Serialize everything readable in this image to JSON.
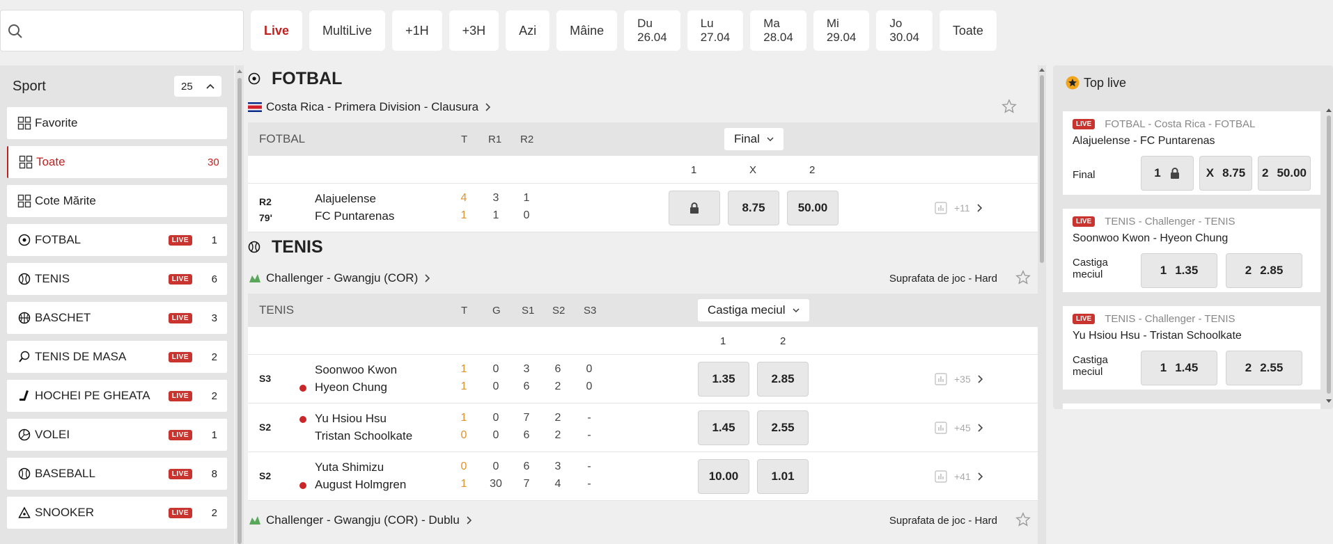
{
  "search": {
    "placeholder": "",
    "value": ""
  },
  "filters": {
    "live": "Live",
    "multilive": "MultiLive",
    "h1": "+1H",
    "h3": "+3H",
    "today": "Azi",
    "tomorrow": "Mâine",
    "dates": [
      {
        "day": "Du",
        "date": "26.04"
      },
      {
        "day": "Lu",
        "date": "27.04"
      },
      {
        "day": "Ma",
        "date": "28.04"
      },
      {
        "day": "Mi",
        "date": "29.04"
      },
      {
        "day": "Jo",
        "date": "30.04"
      }
    ],
    "all": "Toate"
  },
  "sidebar": {
    "title": "Sport",
    "count": "25",
    "items": [
      {
        "label": "Favorite",
        "icon": "grid-icon",
        "live": "",
        "count": ""
      },
      {
        "label": "Toate",
        "icon": "grid-icon",
        "live": "",
        "count": "30"
      },
      {
        "label": "Cote Mărite",
        "icon": "grid-icon",
        "live": "",
        "count": ""
      },
      {
        "label": "FOTBAL",
        "icon": "football-icon",
        "live": "LIVE",
        "count": "1"
      },
      {
        "label": "TENIS",
        "icon": "tennis-icon",
        "live": "LIVE",
        "count": "6"
      },
      {
        "label": "BASCHET",
        "icon": "basketball-icon",
        "live": "LIVE",
        "count": "3"
      },
      {
        "label": "TENIS DE MASA",
        "icon": "table-tennis-icon",
        "live": "LIVE",
        "count": "2"
      },
      {
        "label": "HOCHEI PE GHEATA",
        "icon": "hockey-icon",
        "live": "LIVE",
        "count": "2"
      },
      {
        "label": "VOLEI",
        "icon": "volleyball-icon",
        "live": "LIVE",
        "count": "1"
      },
      {
        "label": "BASEBALL",
        "icon": "baseball-icon",
        "live": "LIVE",
        "count": "8"
      },
      {
        "label": "SNOOKER",
        "icon": "snooker-icon",
        "live": "LIVE",
        "count": "2"
      }
    ]
  },
  "football": {
    "title": "FOTBAL",
    "league": "Costa Rica - Primera Division - Clausura",
    "head": {
      "name": "FOTBAL",
      "cols": [
        "T",
        "R1",
        "R2"
      ],
      "market": "Final",
      "odds": [
        "1",
        "X",
        "2"
      ]
    },
    "rows": [
      {
        "period": "R2",
        "time": "79'",
        "home": "Alajuelense",
        "away": "FC Puntarenas",
        "home_scores": [
          "4",
          "3",
          "1"
        ],
        "away_scores": [
          "1",
          "1",
          "0"
        ],
        "odds": [
          "",
          "8.75",
          "50.00"
        ],
        "more": "+11"
      }
    ]
  },
  "tennis": {
    "title": "TENIS",
    "league": "Challenger - Gwangju (COR)",
    "surface": "Suprafata de joc - Hard",
    "head": {
      "name": "TENIS",
      "cols": [
        "T",
        "G",
        "S1",
        "S2",
        "S3"
      ],
      "market": "Castiga meciul",
      "odds": [
        "1",
        "2"
      ]
    },
    "rows": [
      {
        "period": "S3",
        "home": "Soonwoo Kwon",
        "away": "Hyeon Chung",
        "serve": "away",
        "home_scores": [
          "1",
          "0",
          "3",
          "6",
          "0"
        ],
        "away_scores": [
          "1",
          "0",
          "6",
          "2",
          "0"
        ],
        "odds": [
          "1.35",
          "2.85"
        ],
        "more": "+35"
      },
      {
        "period": "S2",
        "home": "Yu Hsiou Hsu",
        "away": "Tristan Schoolkate",
        "serve": "home",
        "home_scores": [
          "1",
          "0",
          "7",
          "2",
          "-"
        ],
        "away_scores": [
          "0",
          "0",
          "6",
          "2",
          "-"
        ],
        "odds": [
          "1.45",
          "2.55"
        ],
        "more": "+45"
      },
      {
        "period": "S2",
        "home": "Yuta Shimizu",
        "away": "August Holmgren",
        "serve": "away",
        "home_scores": [
          "0",
          "0",
          "6",
          "3",
          "-"
        ],
        "away_scores": [
          "1",
          "30",
          "7",
          "4",
          "-"
        ],
        "odds": [
          "10.00",
          "1.01"
        ],
        "more": "+41"
      }
    ],
    "next_league": "Challenger - Gwangju (COR) - Dublu",
    "next_surface": "Suprafata de joc - Hard"
  },
  "toplive": {
    "title": "Top live",
    "cards": [
      {
        "live": "LIVE",
        "header": "FOTBAL - Costa Rica - FOTBAL",
        "match": "Alajuelense - FC Puntarenas",
        "market": "Final",
        "odds": [
          {
            "k": "1",
            "v": ""
          },
          {
            "k": "X",
            "v": "8.75"
          },
          {
            "k": "2",
            "v": "50.00"
          }
        ]
      },
      {
        "live": "LIVE",
        "header": "TENIS - Challenger - TENIS",
        "match": "Soonwoo Kwon - Hyeon Chung",
        "market1": "Castiga",
        "market2": "meciul",
        "odds": [
          {
            "k": "1",
            "v": "1.35"
          },
          {
            "k": "2",
            "v": "2.85"
          }
        ]
      },
      {
        "live": "LIVE",
        "header": "TENIS - Challenger - TENIS",
        "match": "Yu Hsiou Hsu - Tristan Schoolkate",
        "market1": "Castiga",
        "market2": "meciul",
        "odds": [
          {
            "k": "1",
            "v": "1.45"
          },
          {
            "k": "2",
            "v": "2.55"
          }
        ]
      }
    ]
  },
  "colors": {
    "accent": "#c0211f",
    "live_badge": "#c9342f",
    "score_orange": "#e3912a",
    "serve_dot": "#c9262a"
  }
}
